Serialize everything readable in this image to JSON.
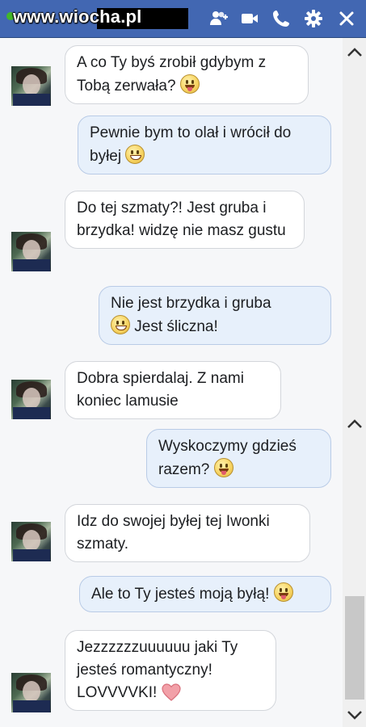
{
  "header": {
    "watermark": "www.wiocha.pl",
    "icons": [
      "add-person-icon",
      "video-camera-icon",
      "phone-icon",
      "gear-icon",
      "close-icon"
    ]
  },
  "colors": {
    "topbar": "#4267b2",
    "incoming_bubble": "#ffffff",
    "outgoing_bubble": "#e7f0fb",
    "status_online": "#42b72a"
  },
  "messages": [
    {
      "from": "them",
      "text": "A co Ty byś zrobił gdybym z Tobą zerwała?",
      "emoji": "tongue-face"
    },
    {
      "from": "me",
      "text": "Pewnie bym to olał i wrócił do byłej",
      "emoji": "grin-face"
    },
    {
      "from": "them",
      "text": "Do tej szmaty?! Jest gruba i brzydka! widzę nie masz gustu",
      "emoji": ""
    },
    {
      "from": "me",
      "text": "Nie jest brzydka i gruba",
      "text2": "Jest śliczna!",
      "emoji": "grin-face"
    },
    {
      "from": "them",
      "text": "Dobra spierdalaj. Z nami koniec lamusie",
      "emoji": ""
    },
    {
      "from": "me",
      "text": "Wyskoczymy gdzieś razem?",
      "emoji": "tongue-face"
    },
    {
      "from": "them",
      "text": "Idz do swojej byłej tej Iwonki szmaty.",
      "emoji": ""
    },
    {
      "from": "me",
      "text": "Ale to Ty jesteś moją byłą!",
      "emoji": "tongue-face"
    },
    {
      "from": "them",
      "text": "Jezzzzzzuuuuuu jaki Ty jesteś romantyczny! LOVVVVKI!",
      "emoji": "heart"
    }
  ]
}
